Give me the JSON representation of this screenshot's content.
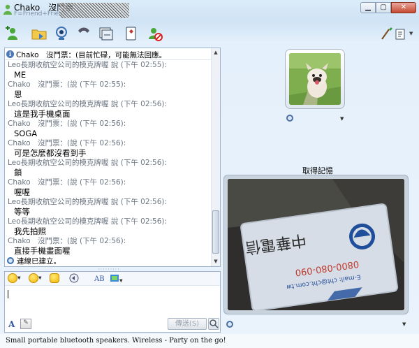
{
  "window": {
    "title": "Chako　沒鬥票",
    "subtitle": "F=Friend+Friend",
    "min_label": "▁",
    "max_label": "▢",
    "close_label": "✕"
  },
  "status_bar": {
    "text": "Chako　沒鬥票：(目前忙碌，可能無法回應。"
  },
  "messages": [
    {
      "kind": "sender",
      "text": "Leo長期收航空公司的模克牌喔 說 (下午 02:55):"
    },
    {
      "kind": "text",
      "text": "ME"
    },
    {
      "kind": "sender",
      "text": "Chako　沒鬥票：(說 (下午 02:55):"
    },
    {
      "kind": "text",
      "text": "恩"
    },
    {
      "kind": "sender",
      "text": "Leo長期收航空公司的模克牌喔 說 (下午 02:56):"
    },
    {
      "kind": "text",
      "text": "這是我手機桌面"
    },
    {
      "kind": "sender",
      "text": "Chako　沒鬥票：(說 (下午 02:56):"
    },
    {
      "kind": "text",
      "text": "SOGA"
    },
    {
      "kind": "sender",
      "text": "Chako　沒鬥票：(說 (下午 02:56):"
    },
    {
      "kind": "text",
      "text": "可是怎麼都沒看到手"
    },
    {
      "kind": "sender",
      "text": "Leo長期收航空公司的模克牌喔 說 (下午 02:56):"
    },
    {
      "kind": "text",
      "text": "鎖"
    },
    {
      "kind": "sender",
      "text": "Chako　沒鬥票：(說 (下午 02:56):"
    },
    {
      "kind": "text",
      "text": "喔喔"
    },
    {
      "kind": "sender",
      "text": "Leo長期收航空公司的模克牌喔 說 (下午 02:56):"
    },
    {
      "kind": "text",
      "text": "等等"
    },
    {
      "kind": "sender",
      "text": "Leo長期收航空公司的模克牌喔 說 (下午 02:56):"
    },
    {
      "kind": "text",
      "text": "我先拍照"
    },
    {
      "kind": "sender",
      "text": "Chako　沒鬥票：(說 (下午 02:56):"
    },
    {
      "kind": "text",
      "text": "直接手機畫面喔"
    }
  ],
  "connection": {
    "text": "連線已建立。"
  },
  "compose": {
    "font_label": "A",
    "send_label": "傳送(S)"
  },
  "webcam": {
    "title": "取得記憶"
  },
  "ad": {
    "text": "Small portable bluetooth speakers. Wireless - Party on the go!"
  }
}
